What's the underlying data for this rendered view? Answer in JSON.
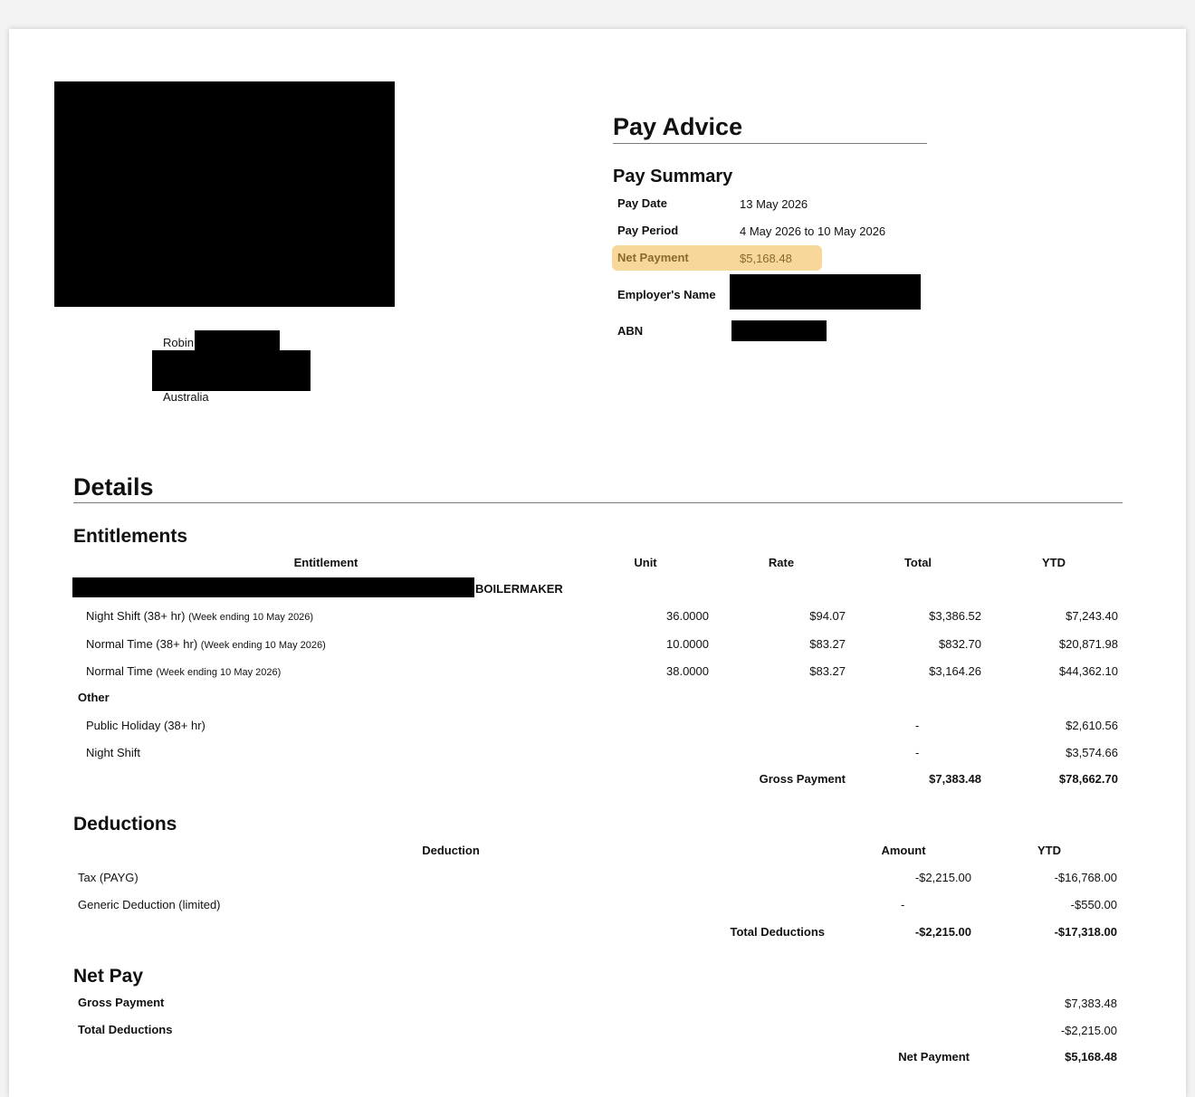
{
  "address": {
    "name_first": "Robin",
    "country": "Australia"
  },
  "pay_advice": {
    "title": "Pay Advice",
    "summary_title": "Pay Summary",
    "pay_date_label": "Pay Date",
    "pay_date": "13 May 2026",
    "pay_period_label": "Pay Period",
    "pay_period": "4 May 2026 to 10 May 2026",
    "net_payment_label": "Net Payment",
    "net_payment": "$5,168.48",
    "employer_label": "Employer's Name",
    "abn_label": "ABN",
    "highlight_color": "#f7d89a"
  },
  "details": {
    "title": "Details"
  },
  "entitlements": {
    "title": "Entitlements",
    "headers": {
      "entitlement": "Entitlement",
      "unit": "Unit",
      "rate": "Rate",
      "total": "Total",
      "ytd": "YTD"
    },
    "group_label": "BOILERMAKER",
    "rows": [
      {
        "name": "Night Shift (38+ hr)",
        "note": "(Week ending 10 May 2026)",
        "unit": "36.0000",
        "rate": "$94.07",
        "total": "$3,386.52",
        "ytd": "$7,243.40"
      },
      {
        "name": "Normal Time (38+ hr)",
        "note": "(Week ending 10 May 2026)",
        "unit": "10.0000",
        "rate": "$83.27",
        "total": "$832.70",
        "ytd": "$20,871.98"
      },
      {
        "name": "Normal Time",
        "note": "(Week ending 10 May 2026)",
        "unit": "38.0000",
        "rate": "$83.27",
        "total": "$3,164.26",
        "ytd": "$44,362.10"
      }
    ],
    "other_label": "Other",
    "other_rows": [
      {
        "name": "Public Holiday (38+ hr)",
        "total": "-",
        "ytd": "$2,610.56"
      },
      {
        "name": "Night Shift",
        "total": "-",
        "ytd": "$3,574.66"
      }
    ],
    "gross_label": "Gross Payment",
    "gross_total": "$7,383.48",
    "gross_ytd": "$78,662.70"
  },
  "deductions": {
    "title": "Deductions",
    "headers": {
      "deduction": "Deduction",
      "amount": "Amount",
      "ytd": "YTD"
    },
    "rows": [
      {
        "name": "Tax (PAYG)",
        "amount": "-$2,215.00",
        "ytd": "-$16,768.00"
      },
      {
        "name": "Generic Deduction (limited)",
        "amount": "-",
        "ytd": "-$550.00"
      }
    ],
    "total_label": "Total Deductions",
    "total_amount": "-$2,215.00",
    "total_ytd": "-$17,318.00"
  },
  "net_pay": {
    "title": "Net Pay",
    "gross_label": "Gross Payment",
    "gross_value": "$7,383.48",
    "deductions_label": "Total Deductions",
    "deductions_value": "-$2,215.00",
    "net_label": "Net Payment",
    "net_value": "$5,168.48"
  }
}
